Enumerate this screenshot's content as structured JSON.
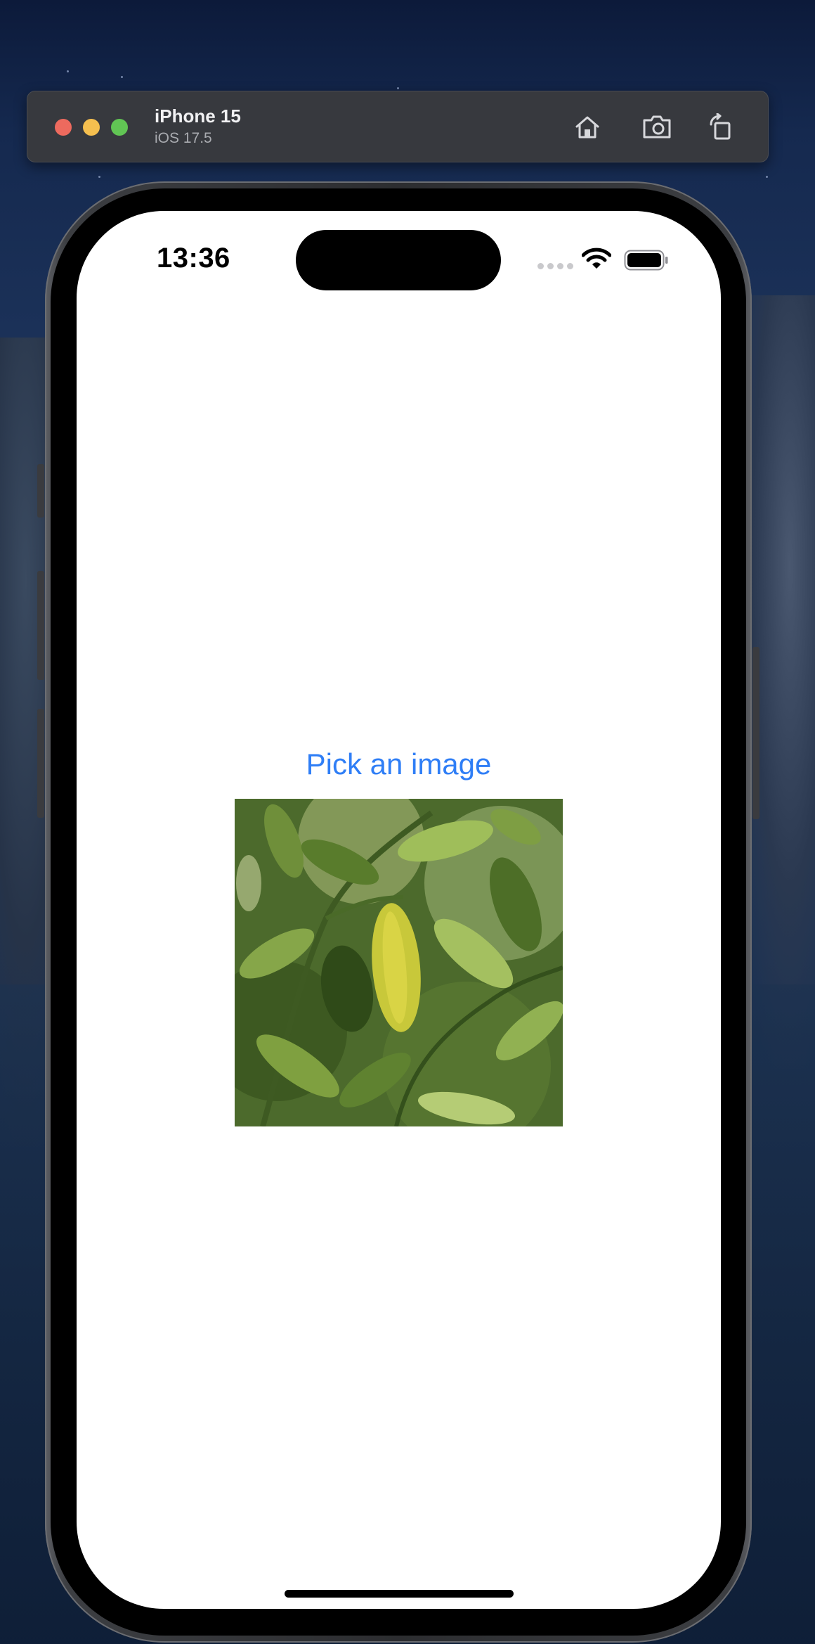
{
  "simulator": {
    "device_name": "iPhone 15",
    "os_version": "iOS 17.5",
    "toolbar_icons": [
      "home-icon",
      "screenshot-icon",
      "rotate-icon"
    ]
  },
  "status_bar": {
    "time": "13:36",
    "icons": [
      "cellular-signal-icon",
      "wifi-icon",
      "battery-icon"
    ]
  },
  "content": {
    "pick_button_label": "Pick an image",
    "photo_subject": "picked-photo"
  },
  "colors": {
    "accent": "#2f7ef6",
    "toolbar_bg": "#37393e",
    "traffic_close": "#ed6a5e",
    "traffic_minimize": "#f5bf4f",
    "traffic_maximize": "#61c554"
  }
}
